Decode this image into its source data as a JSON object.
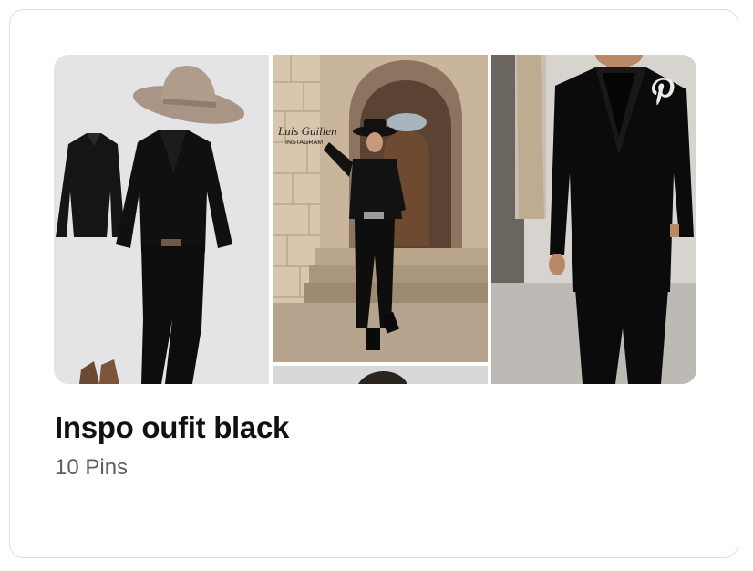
{
  "board": {
    "title": "Inspo oufit black",
    "pin_count": "10 Pins",
    "images": [
      {
        "description": "flat-lay: tan cowboy hat, black shirt, black blazer, black jeans, brown boots"
      },
      {
        "description": "man in black western outfit and cowboy hat on stone steps"
      },
      {
        "description": "partially visible photo of a man"
      },
      {
        "description": "man in black suit"
      }
    ],
    "watermark_text": "Luis Guillen INSTAGRAM",
    "brand_icon": "pinterest-icon"
  },
  "colors": {
    "title": "#111111",
    "subtitle": "#5f5f5f",
    "border": "#dedede"
  }
}
